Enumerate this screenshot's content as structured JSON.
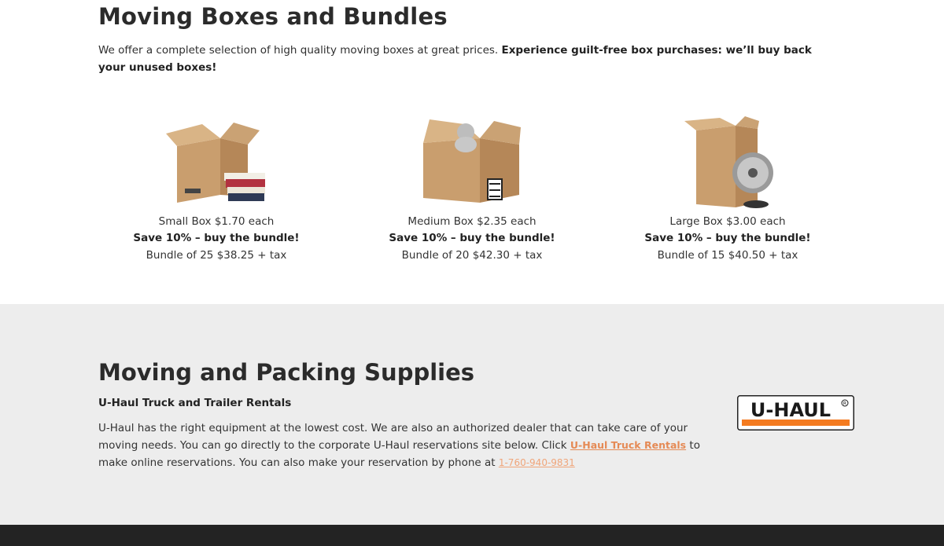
{
  "boxes_section": {
    "title": "Moving Boxes and Bundles",
    "intro_plain": "We offer a complete selection of high quality moving boxes at great prices. ",
    "intro_bold": "Experience guilt-free box purchases: we’ll buy back your unused boxes!"
  },
  "products": [
    {
      "price_line": "Small Box $1.70 each",
      "save_line": "Save 10% – buy the bundle!",
      "bundle_line": "Bundle of 25 $38.25 + tax"
    },
    {
      "price_line": "Medium Box $2.35 each",
      "save_line": "Save 10% – buy the bundle!",
      "bundle_line": "Bundle of 20 $42.30 + tax"
    },
    {
      "price_line": "Large Box $3.00 each",
      "save_line": "Save 10% – buy the bundle!",
      "bundle_line": "Bundle of 15 $40.50 + tax"
    }
  ],
  "supplies_section": {
    "title": "Moving and Packing Supplies",
    "subhead": "U-Haul Truck and Trailer Rentals",
    "body_1": "U-Haul has the right equipment at the lowest cost. We are also an authorized dealer that can take care of your moving needs.  You can go directly to the corporate U-Haul reservations site below. Click ",
    "link_label": "U-Haul Truck Rentals",
    "body_2": " to make online reservations. You can also make your reservation by phone at ",
    "phone": "1-760-940-9831",
    "logo_text": "U-HAUL"
  },
  "colors": {
    "accent_link": "#e58a55",
    "uhaul_orange": "#f47b20",
    "gray_band": "#ededed",
    "footer": "#232323"
  }
}
